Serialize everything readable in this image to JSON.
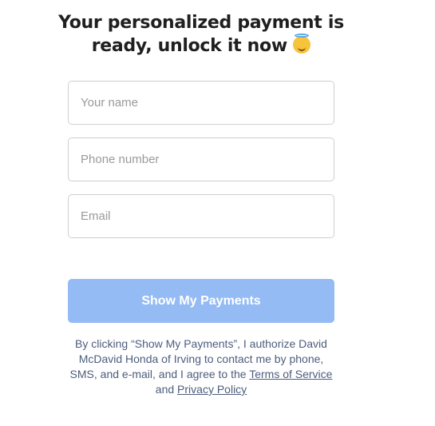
{
  "heading": {
    "line1": "Your personalized payment is",
    "line2": "ready, unlock it now"
  },
  "heading_emoji": "smiling-face-with-halo-icon",
  "form": {
    "name_placeholder": "Your name",
    "phone_placeholder": "Phone number",
    "email_placeholder": "Email",
    "name_value": "",
    "phone_value": "",
    "email_value": ""
  },
  "submit_label": "Show My Payments",
  "disclaimer": {
    "text": "By clicking “Show My Payments”, I authorize David McDavid Honda of Irving to contact me by phone, SMS, and e-mail, and I agree to the ",
    "terms_link": "Terms of Service",
    "and": " and ",
    "privacy_link": "Privacy Policy"
  },
  "colors": {
    "button": "#94bbf3",
    "disclaimer": "#4c5d7d",
    "heading": "#1f1f1f"
  }
}
